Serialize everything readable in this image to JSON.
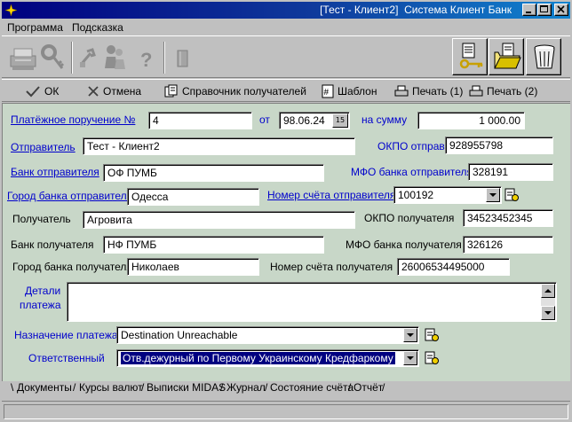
{
  "window": {
    "title": "[Тест - Клиент2]  Система Клиент Банк"
  },
  "menu": {
    "items": [
      "Программа",
      "Подсказка"
    ]
  },
  "toolbar": {
    "icons": [
      "printer-disabled-icon",
      "key-disabled-icon",
      "tools-disabled-icon",
      "people-disabled-icon",
      "help-disabled-icon",
      "door-disabled-icon",
      "user-key-icon",
      "folder-open-icon",
      "trash-icon"
    ]
  },
  "actions": {
    "ok": "ОК",
    "cancel": "Отмена",
    "directory": "Справочник получателей",
    "template": "Шаблон",
    "print1": "Печать (1)",
    "print2": "Печать (2)"
  },
  "form": {
    "order_no_label": "Платёжное поручение №",
    "order_no": "4",
    "date_label": "от",
    "date": "98.06.24",
    "date_btn": "15",
    "sum_label": "на сумму",
    "sum": "1 000.00",
    "sender_label": "Отправитель",
    "sender": "Тест - Клиент2",
    "sender_okpo_label": "ОКПО отправителя",
    "sender_okpo": "928955798",
    "sender_bank_label": "Банк отправителя",
    "sender_bank": "ОФ ПУМБ",
    "sender_mfo_label": "МФО банка отправителя",
    "sender_mfo": "328191",
    "sender_city_label": "Город банка отправителя",
    "sender_city": "Одесса",
    "sender_account_label": "Номер счёта отправителя",
    "sender_account": "100192",
    "receiver_label": "Получатель",
    "receiver": "Агровита",
    "receiver_okpo_label": "ОКПО получателя",
    "receiver_okpo": "34523452345",
    "receiver_bank_label": "Банк получателя",
    "receiver_bank": "НФ ПУМБ",
    "receiver_mfo_label": "МФО банка получателя",
    "receiver_mfo": "326126",
    "receiver_city_label": "Город банка получателя",
    "receiver_city": "Николаев",
    "receiver_account_label": "Номер счёта получателя",
    "receiver_account": "26006534495000",
    "details_label_1": "Детали",
    "details_label_2": "платежа",
    "details": "",
    "purpose_label": "Назначение платежа",
    "purpose": "Destination Unreachable",
    "responsible_label": "Ответственный",
    "responsible": "Отв.дежурный по Первому Украинскому Кредфаркому"
  },
  "tabs": [
    "Документы",
    "Курсы валют",
    "Выписки MIDAS",
    "Журнал",
    "Состояние счёта",
    "Отчёт"
  ],
  "colors": {
    "titlebar": "#000080",
    "panel": "#c8d7c8",
    "link": "#0000cc"
  }
}
